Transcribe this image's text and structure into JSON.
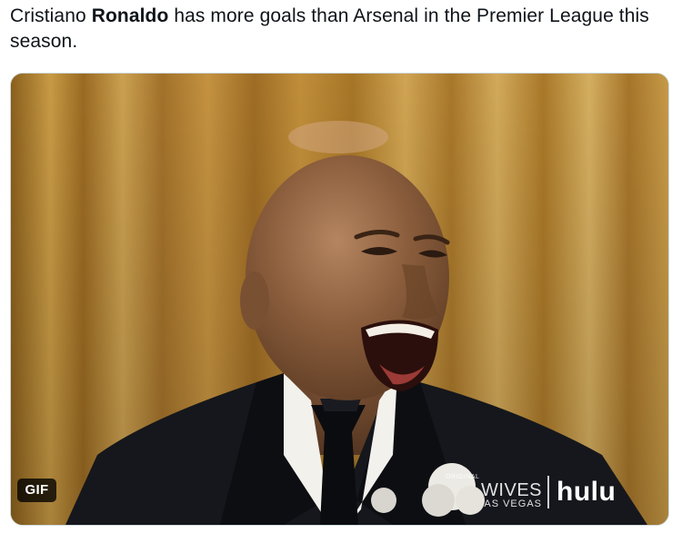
{
  "tweet": {
    "text_before": "Cristiano ",
    "text_bold": "Ronaldo",
    "text_after": " has more goals than Arsenal in the Premier League this season."
  },
  "media": {
    "badge": "GIF",
    "watermark_show_small": "ORIGINAL",
    "watermark_show_main": "WIVES",
    "watermark_show_sub": "AS VEGAS",
    "watermark_brand": "hulu"
  },
  "colors": {
    "curtain": "#b8862e",
    "suit": "#121419",
    "skin": "#7a5234",
    "badge_bg": "#000000"
  },
  "icons": [
    "gif-badge"
  ]
}
